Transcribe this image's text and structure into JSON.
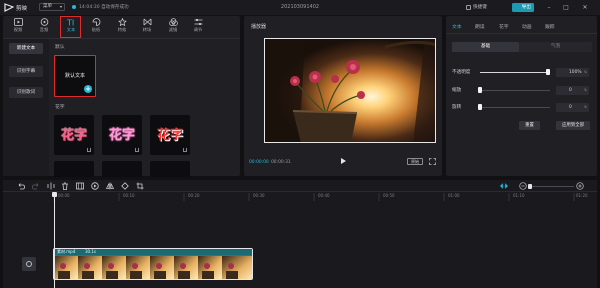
{
  "app": {
    "name": "剪映",
    "menu_label": "菜单",
    "save_status": "14:04:30 自动保存成功",
    "project_title": "202103091402",
    "shortcut_label": "快捷键",
    "export_label": "导出"
  },
  "tool_tabs": [
    {
      "label": "视频",
      "icon": "video-icon"
    },
    {
      "label": "音频",
      "icon": "audio-icon"
    },
    {
      "label": "文本",
      "icon": "text-icon"
    },
    {
      "label": "贴纸",
      "icon": "sticker-icon"
    },
    {
      "label": "特效",
      "icon": "effects-icon"
    },
    {
      "label": "转场",
      "icon": "transition-icon"
    },
    {
      "label": "滤镜",
      "icon": "filter-icon"
    },
    {
      "label": "调节",
      "icon": "adjust-icon"
    }
  ],
  "text_sidebar": [
    "新建文本",
    "识别字幕",
    "识别歌词"
  ],
  "text_library": {
    "default_section": "默认",
    "default_card_label": "默认文本",
    "flower_section": "花字",
    "flower_samples": [
      {
        "text": "花字",
        "color": "#ff5a8a"
      },
      {
        "text": "花字",
        "color": "#ff9ad0"
      },
      {
        "text": "花字",
        "color": "#ff3030"
      }
    ]
  },
  "player": {
    "title": "播放器",
    "current_time": "00:00:00",
    "total_time": "00:00:31",
    "ratio_label": "原始"
  },
  "properties": {
    "tabs": [
      "文本",
      "朗读",
      "花字",
      "动画",
      "跟踪"
    ],
    "segments": [
      "基础",
      "气泡"
    ],
    "opacity_label": "不透明度",
    "opacity_value": "100%",
    "opacity_level": 1.0,
    "scale_label": "缩放",
    "scale_value": "0",
    "scale_level": 0,
    "rotation_label": "旋转",
    "rotation_value": "0",
    "rotation_level": 0,
    "reset_label": "重置",
    "apply_all_label": "应用到全部"
  },
  "timeline": {
    "ruler_labels": [
      "00:00",
      "00:10",
      "00:20",
      "00:30",
      "00:40",
      "00:50",
      "01:00",
      "01:10",
      "01:20"
    ],
    "clip_name": "素材.mp4",
    "clip_duration": "30.1s"
  },
  "colors": {
    "accent": "#1fb7d3",
    "highlight_red": "#e02b2b",
    "clip_teal": "#1d7a86"
  }
}
